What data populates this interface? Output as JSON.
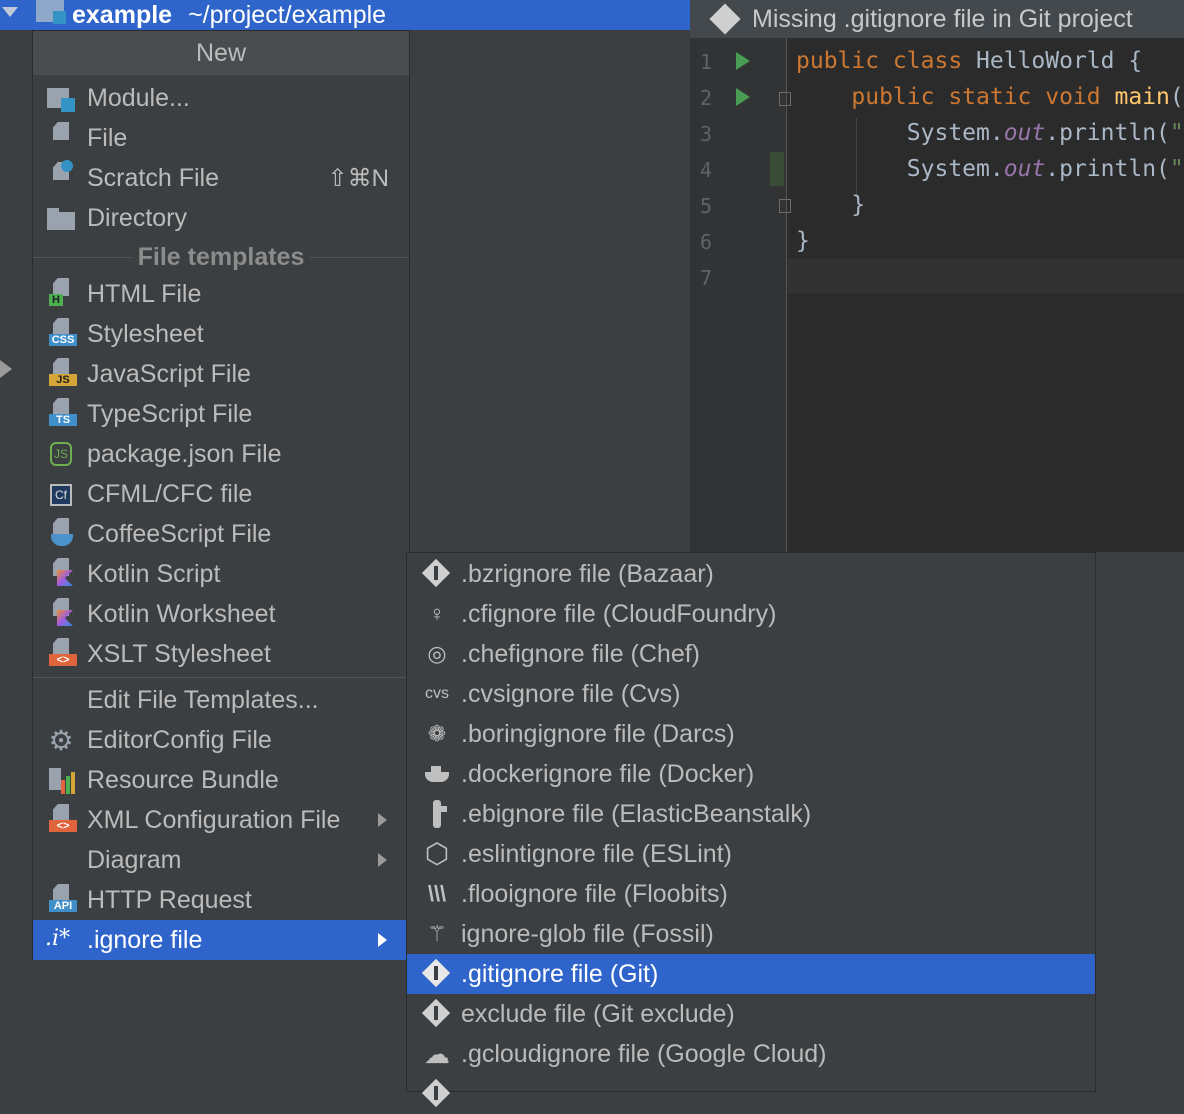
{
  "project": {
    "name": "example",
    "path": "~/project/example"
  },
  "banner": {
    "text": "Missing .gitignore file in Git project"
  },
  "editor": {
    "line_numbers": [
      "1",
      "2",
      "3",
      "4",
      "5",
      "6",
      "7"
    ]
  },
  "menu": {
    "title": "New",
    "items_top": [
      {
        "label": "Module...",
        "icon": "module-icon"
      },
      {
        "label": "File",
        "icon": "file-icon"
      },
      {
        "label": "Scratch File",
        "icon": "scratch-file-icon",
        "shortcut": "⇧⌘N"
      },
      {
        "label": "Directory",
        "icon": "folder-icon"
      }
    ],
    "section_label": "File templates",
    "templates": [
      {
        "label": "HTML File",
        "badge": "H",
        "badge_color": "#4caf50"
      },
      {
        "label": "Stylesheet",
        "badge": "CSS",
        "badge_color": "#3f8fcb"
      },
      {
        "label": "JavaScript File",
        "badge": "JS",
        "badge_color": "#d6a537"
      },
      {
        "label": "TypeScript File",
        "badge": "TS",
        "badge_color": "#3f8fcb"
      },
      {
        "label": "package.json File",
        "icon": "nodejs-icon"
      },
      {
        "label": "CFML/CFC file",
        "icon": "cfml-icon"
      },
      {
        "label": "CoffeeScript File",
        "icon": "coffeescript-icon"
      },
      {
        "label": "Kotlin Script",
        "icon": "kotlin-icon"
      },
      {
        "label": "Kotlin Worksheet",
        "icon": "kotlin-icon"
      },
      {
        "label": "XSLT Stylesheet",
        "badge": "<>",
        "badge_color": "#e0643c"
      }
    ],
    "items_bottom": [
      {
        "label": "Edit File Templates..."
      },
      {
        "label": "EditorConfig File",
        "icon": "gear-icon"
      },
      {
        "label": "Resource Bundle",
        "icon": "resource-bundle-icon"
      },
      {
        "label": "XML Configuration File",
        "icon": "xml-icon",
        "submenu": true
      },
      {
        "label": "Diagram",
        "submenu": true
      },
      {
        "label": "HTTP Request",
        "icon": "api-icon"
      },
      {
        "label": ".ignore file",
        "icon_text": ".i*",
        "submenu": true,
        "selected": true
      }
    ]
  },
  "submenu": {
    "items": [
      {
        "label": ".bzrignore file (Bazaar)",
        "icon": "bazaar-icon"
      },
      {
        "label": ".cfignore file (CloudFoundry)",
        "icon": "cloudfoundry-icon"
      },
      {
        "label": ".chefignore file (Chef)",
        "icon": "chef-icon"
      },
      {
        "label": ".cvsignore file (Cvs)",
        "icon_text": "cvs"
      },
      {
        "label": ".boringignore file (Darcs)",
        "icon": "darcs-icon"
      },
      {
        "label": ".dockerignore file (Docker)",
        "icon": "docker-icon"
      },
      {
        "label": ".ebignore file (ElasticBeanstalk)",
        "icon": "elasticbeanstalk-icon"
      },
      {
        "label": ".eslintignore file (ESLint)",
        "icon": "eslint-icon"
      },
      {
        "label": ".flooignore file (Floobits)",
        "icon": "floobits-icon"
      },
      {
        "label": "ignore-glob file (Fossil)",
        "icon": "fossil-icon"
      },
      {
        "label": ".gitignore file (Git)",
        "icon": "git-icon",
        "selected": true
      },
      {
        "label": "exclude file (Git exclude)",
        "icon": "git-icon"
      },
      {
        "label": ".gcloudignore file (Google Cloud)",
        "icon": "google-cloud-icon"
      }
    ]
  },
  "colors": {
    "selection": "#2f65ca",
    "menu_bg": "#3c3f41",
    "editor_bg": "#2b2b2b"
  }
}
